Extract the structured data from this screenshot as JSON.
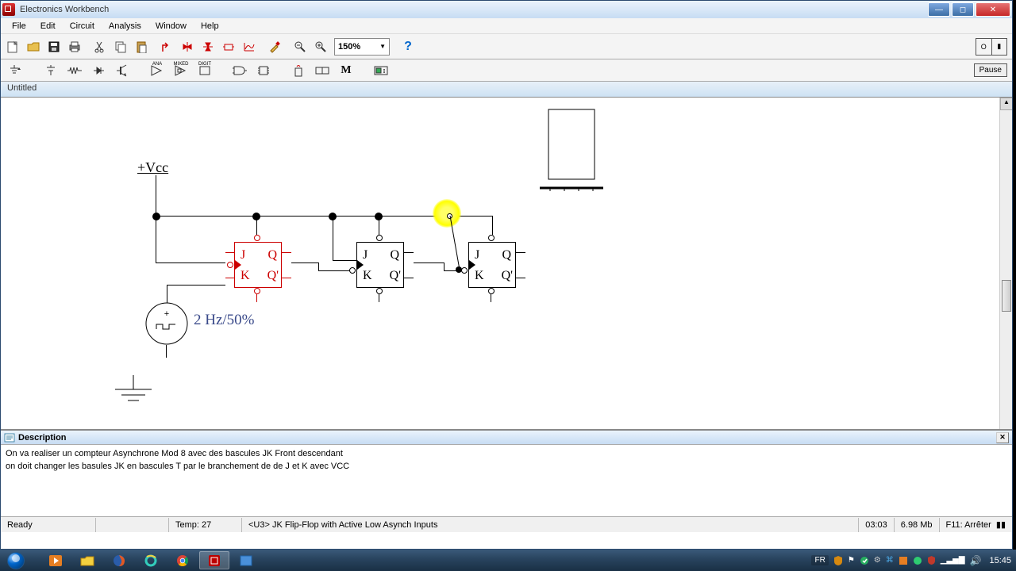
{
  "title": "Electronics Workbench",
  "menus": [
    "File",
    "Edit",
    "Circuit",
    "Analysis",
    "Window",
    "Help"
  ],
  "zoom": "150%",
  "pause": "Pause",
  "doc_tab": "Untitled",
  "schematic": {
    "vcc": "+Vcc",
    "clock": "2 Hz/50%",
    "ff": {
      "j": "J",
      "k": "K",
      "q": "Q",
      "qb": "Q'"
    }
  },
  "desc": {
    "title": "Description",
    "line1": "On va realiser un compteur Asynchrone Mod 8 avec des bascules JK Front descendant",
    "line2": "on doit changer les basules JK en  bascules T par le branchement de de J et K avec VCC"
  },
  "status": {
    "ready": "Ready",
    "temp": "Temp:  27",
    "hint": "<U3> JK Flip-Flop with Active Low Asynch Inputs",
    "time1": "03:03",
    "mem": "6.98 Mb",
    "f11": "F11: Arrêter"
  },
  "taskbar": {
    "lang": "FR",
    "clock": "15:45"
  }
}
